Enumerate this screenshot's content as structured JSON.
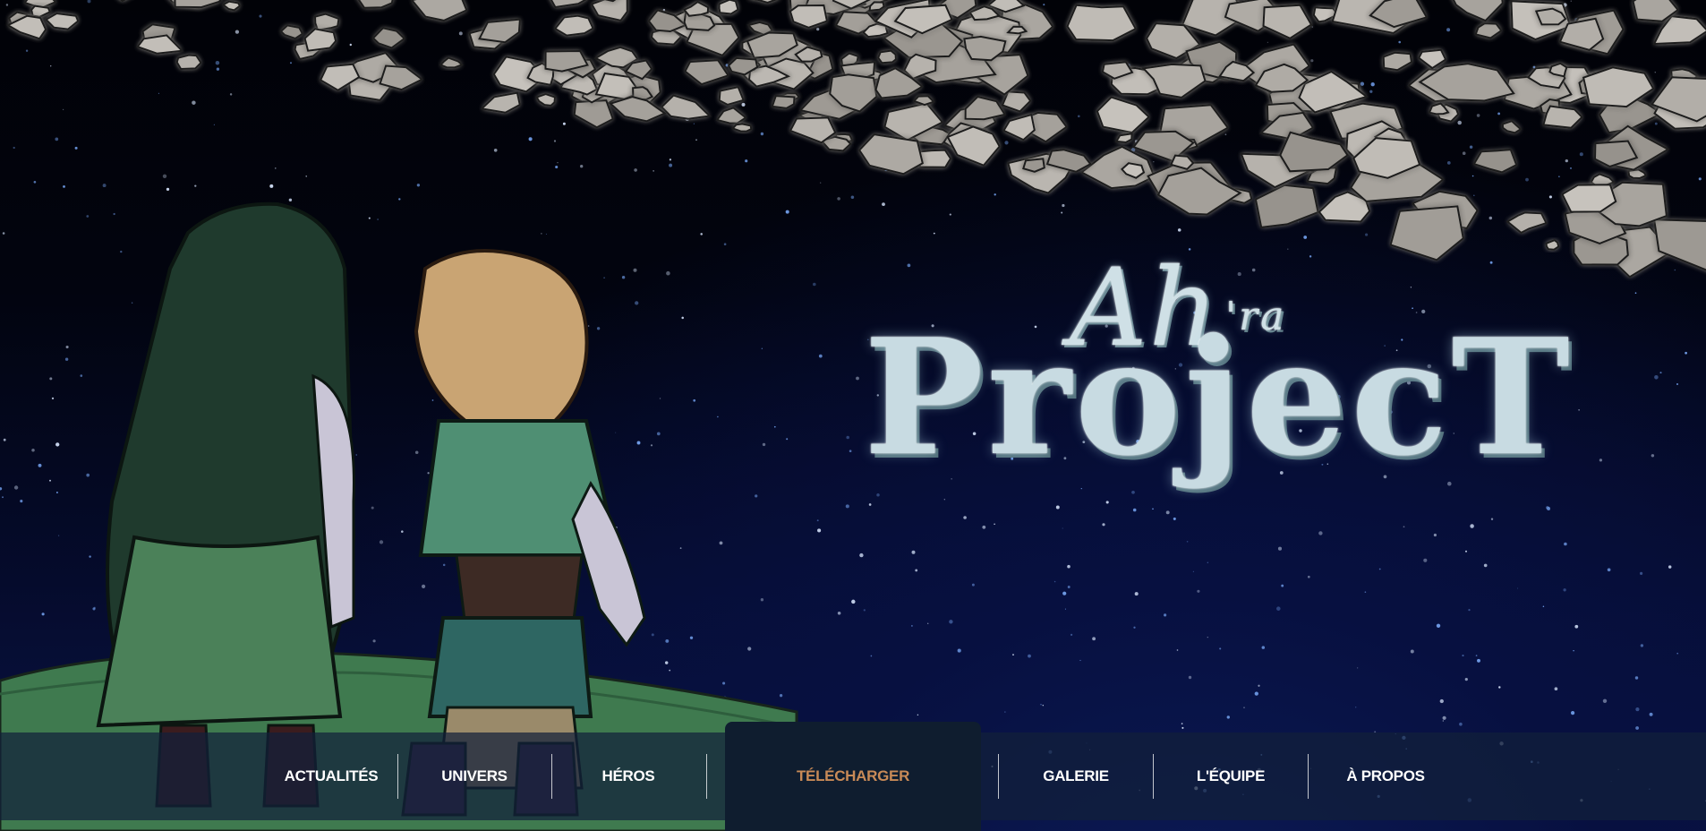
{
  "logo": {
    "top_text": "Ah",
    "top_suffix": "'ra",
    "main_text": "ProjecT"
  },
  "nav": {
    "items": [
      {
        "label": "ACTUALITÉS"
      },
      {
        "label": "UNIVERS"
      },
      {
        "label": "HÉROS"
      },
      {
        "label": "TÉLÉCHARGER",
        "active": true
      },
      {
        "label": "GALERIE"
      },
      {
        "label": "L'ÉQUIPE"
      },
      {
        "label": "À PROPOS"
      }
    ]
  },
  "colors": {
    "nav_active_text": "#c88a57",
    "nav_text": "#ffffff",
    "nav_background": "#12203a"
  }
}
